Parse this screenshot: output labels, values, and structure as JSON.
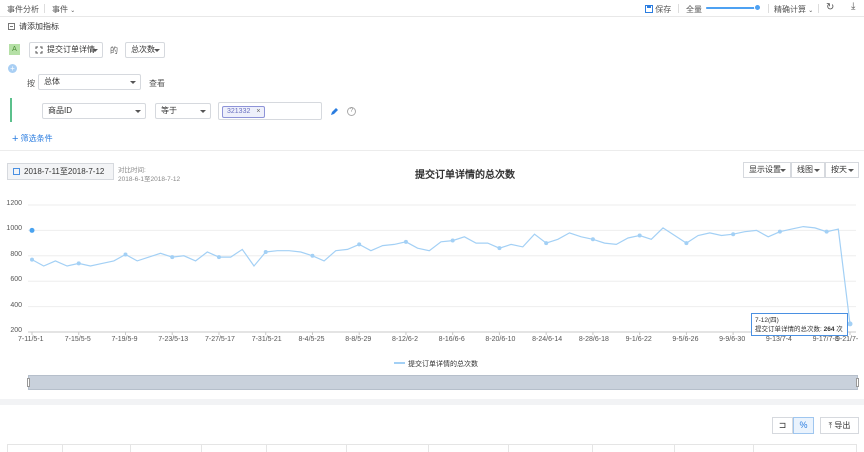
{
  "topbar": {
    "event_analysis": "事件分析",
    "event": "事件",
    "save": "保存",
    "full": "全量",
    "precise_calc": "精确计算",
    "sample_level": 1.0
  },
  "metric_section": {
    "header": "请添加指标",
    "badge": "A",
    "event_select": "提交订单详情",
    "of_label": "的",
    "measure_select": "总次数"
  },
  "group_by": {
    "by_label": "按",
    "dimension": "总体",
    "view_label": "查看"
  },
  "filter": {
    "property": "商品ID",
    "operator": "等于",
    "tag": "321332"
  },
  "add_filter": "筛选条件",
  "date_range": "2018-7-11至2018-7-12",
  "compare": {
    "label": "对比时间:",
    "range": "2018-6-1至2018-7-12"
  },
  "chart_controls": {
    "display": "显示设置",
    "chart_type": "线图",
    "granularity": "按天"
  },
  "tooltip": {
    "date": "7-12(四)",
    "label": "提交订单详情的总次数:",
    "value": "264",
    "unit": "次"
  },
  "legend_label": "提交订单详情的总次数",
  "bottom": {
    "percent": "%",
    "export": "导出"
  },
  "chart_data": {
    "type": "line",
    "title": "提交订单详情的总次数",
    "ylim": [
      200,
      1200
    ],
    "yticks": [
      200,
      400,
      600,
      800,
      1000,
      1200
    ],
    "xtick_labels": [
      "7-11/5-1",
      "7-15/5-5",
      "7-19/5-9",
      "7-23/5-13",
      "7-27/5-17",
      "7-31/5-21",
      "8-4/5-25",
      "8-8/5-29",
      "8-12/6-2",
      "8-16/6-6",
      "8-20/6-10",
      "8-24/6-14",
      "8-28/6-18",
      "9-1/6-22",
      "9-5/6-26",
      "9-9/6-30",
      "9-13/7-4",
      "9-17/7-8",
      "9-21/7-"
    ],
    "grid": true,
    "legend": "bottom",
    "series": [
      {
        "name": "提交订单详情的总次数",
        "color": "#a3d0f5",
        "values": [
          770,
          720,
          760,
          720,
          740,
          720,
          740,
          760,
          810,
          760,
          790,
          820,
          790,
          800,
          760,
          830,
          790,
          790,
          850,
          720,
          830,
          840,
          840,
          830,
          800,
          760,
          840,
          850,
          890,
          840,
          880,
          890,
          910,
          860,
          840,
          910,
          920,
          950,
          900,
          900,
          860,
          890,
          870,
          970,
          900,
          930,
          980,
          950,
          930,
          900,
          890,
          940,
          960,
          930,
          1020,
          960,
          900,
          960,
          980,
          960,
          970,
          990,
          1000,
          950,
          990,
          1010,
          1030,
          1020,
          990,
          1010,
          264
        ]
      },
      {
        "name": "提交订单详情的总次数 (7-11)",
        "color": "#4aa3f0",
        "values": [
          1000
        ]
      }
    ]
  }
}
